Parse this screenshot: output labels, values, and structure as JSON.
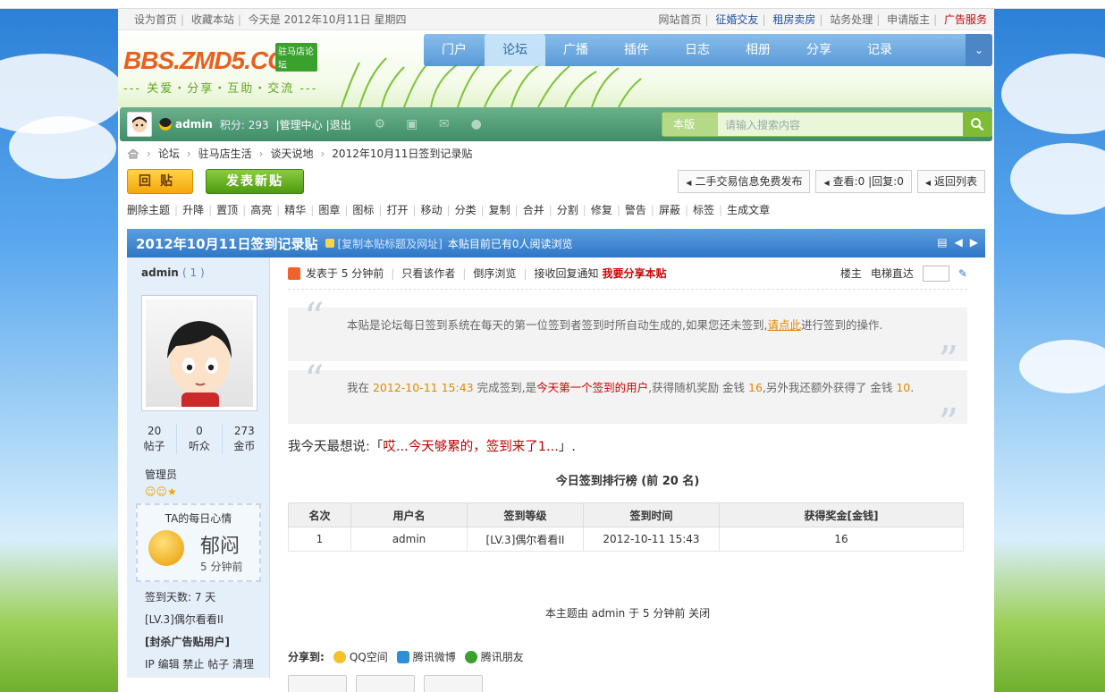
{
  "topbar": {
    "left": [
      "设为首页",
      "收藏本站",
      "今天是  2012年10月11日 星期四"
    ],
    "right": [
      {
        "label": "网站首页",
        "style": "normal"
      },
      {
        "label": "征婚交友",
        "style": "hl"
      },
      {
        "label": "租房卖房",
        "style": "hl"
      },
      {
        "label": "站务处理",
        "style": "normal"
      },
      {
        "label": "申请版主",
        "style": "normal"
      },
      {
        "label": "广告服务",
        "style": "red"
      }
    ]
  },
  "logo": {
    "text": "BBS.ZMD5.COM",
    "badge": "驻马店论坛",
    "slogan": "--- 关爱・分享・互助・交流 ---"
  },
  "nav": {
    "items": [
      "门户",
      "论坛",
      "广播",
      "插件",
      "日志",
      "相册",
      "分享",
      "记录"
    ],
    "active": 1,
    "more": "⌄"
  },
  "user": {
    "name": "admin",
    "score": "积分: 293",
    "admin_center": "|管理中心",
    "logout": "|退出"
  },
  "search": {
    "scope": "本版",
    "placeholder": "请输入搜索内容"
  },
  "breadcrumb": [
    "论坛",
    "驻马店生活",
    "谈天说地",
    "2012年10月11日签到记录贴"
  ],
  "actions": {
    "reply": "回贴",
    "new_post": "发表新贴",
    "pills": [
      "二手交易信息免费发布",
      "查看:0 |回复:0",
      "返回列表"
    ]
  },
  "modtools": [
    "删除主题",
    "升降",
    "置顶",
    "高亮",
    "精华",
    "图章",
    "图标",
    "打开",
    "移动",
    "分类",
    "复制",
    "合并",
    "分割",
    "修复",
    "警告",
    "屏蔽",
    "标签",
    "生成文章"
  ],
  "post": {
    "title": "2012年10月11日签到记录贴",
    "copy_link": "[复制本贴标题及网址]",
    "viewing": "本贴目前已有0人阅读浏览",
    "author": "admin",
    "uid": "( 1 )",
    "stats": [
      {
        "value": "20",
        "label": "帖子"
      },
      {
        "value": "0",
        "label": "听众"
      },
      {
        "value": "273",
        "label": "金币"
      }
    ],
    "group": "管理员",
    "mood_title": "TA的每日心情",
    "mood": "郁闷",
    "mood_time": "5 分钟前",
    "sign_days": "签到天数: 7 天",
    "level": "[LV.3]偶尔看看II",
    "ban_ad": "[封杀广告贴用户]",
    "ops": "IP 编辑 禁止 帖子 清理",
    "meta": {
      "posted": "发表于 5 分钟前",
      "only_author": "只看该作者",
      "reverse": "倒序浏览",
      "notify": "接收回复通知",
      "share": "我要分享本贴",
      "floor": "楼主",
      "elevator": "电梯直达"
    },
    "quote1_a": "本贴是论坛每日签到系统在每天的第一位签到者签到时所自动生成的,如果您还未签到,",
    "quote1_link": "请点此",
    "quote1_b": "进行签到的操作.",
    "quote2": {
      "p1": "我在 ",
      "time": "2012-10-11 15:43",
      "p2": " 完成签到,是",
      "first": "今天第一个签到的用户",
      "p3": ",获得随机奖励 金钱 ",
      "reward": "16",
      "p4": ",另外我还额外获得了 金钱 ",
      "extra": "10",
      "p5": "."
    },
    "say_prefix": "我今天最想说:「",
    "say_text": "哎...今天够累的，签到来了1...",
    "say_suffix": "」.",
    "rank_title": "今日签到排行榜 (前 20 名)",
    "table": {
      "headers": [
        "名次",
        "用户名",
        "签到等级",
        "签到时间",
        "获得奖金[金钱]"
      ],
      "rows": [
        [
          "1",
          "admin",
          "[LV.3]偶尔看看II",
          "2012-10-11 15:43",
          "16"
        ]
      ]
    },
    "closed": "本主题由 admin 于 5 分钟前 关闭",
    "share_label": "分享到:",
    "share_items": [
      "QQ空间",
      "腾讯微博",
      "腾讯朋友"
    ]
  },
  "colors": {
    "accent": "#2e76c6",
    "green": "#4d9a10",
    "orange": "#e08800",
    "red": "#d10000"
  }
}
